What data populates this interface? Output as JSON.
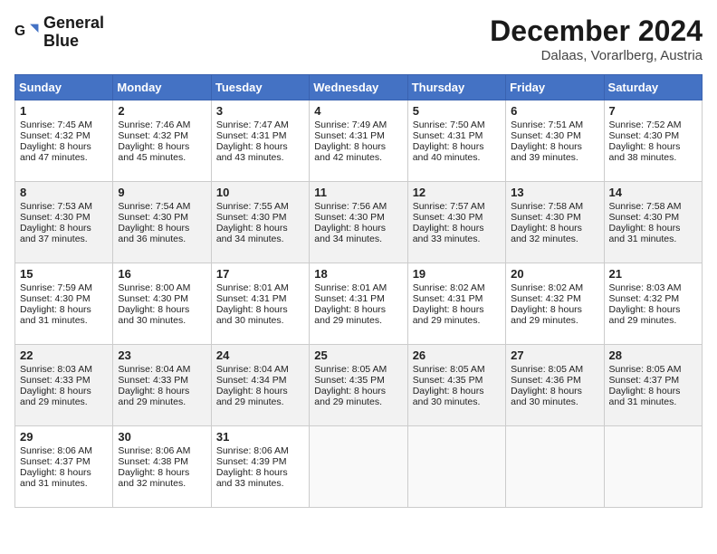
{
  "logo": {
    "line1": "General",
    "line2": "Blue"
  },
  "title": "December 2024",
  "location": "Dalaas, Vorarlberg, Austria",
  "days_of_week": [
    "Sunday",
    "Monday",
    "Tuesday",
    "Wednesday",
    "Thursday",
    "Friday",
    "Saturday"
  ],
  "weeks": [
    [
      {
        "day": 1,
        "sunrise": "7:45 AM",
        "sunset": "4:32 PM",
        "daylight": "8 hours and 47 minutes."
      },
      {
        "day": 2,
        "sunrise": "7:46 AM",
        "sunset": "4:32 PM",
        "daylight": "8 hours and 45 minutes."
      },
      {
        "day": 3,
        "sunrise": "7:47 AM",
        "sunset": "4:31 PM",
        "daylight": "8 hours and 43 minutes."
      },
      {
        "day": 4,
        "sunrise": "7:49 AM",
        "sunset": "4:31 PM",
        "daylight": "8 hours and 42 minutes."
      },
      {
        "day": 5,
        "sunrise": "7:50 AM",
        "sunset": "4:31 PM",
        "daylight": "8 hours and 40 minutes."
      },
      {
        "day": 6,
        "sunrise": "7:51 AM",
        "sunset": "4:30 PM",
        "daylight": "8 hours and 39 minutes."
      },
      {
        "day": 7,
        "sunrise": "7:52 AM",
        "sunset": "4:30 PM",
        "daylight": "8 hours and 38 minutes."
      }
    ],
    [
      {
        "day": 8,
        "sunrise": "7:53 AM",
        "sunset": "4:30 PM",
        "daylight": "8 hours and 37 minutes."
      },
      {
        "day": 9,
        "sunrise": "7:54 AM",
        "sunset": "4:30 PM",
        "daylight": "8 hours and 36 minutes."
      },
      {
        "day": 10,
        "sunrise": "7:55 AM",
        "sunset": "4:30 PM",
        "daylight": "8 hours and 34 minutes."
      },
      {
        "day": 11,
        "sunrise": "7:56 AM",
        "sunset": "4:30 PM",
        "daylight": "8 hours and 34 minutes."
      },
      {
        "day": 12,
        "sunrise": "7:57 AM",
        "sunset": "4:30 PM",
        "daylight": "8 hours and 33 minutes."
      },
      {
        "day": 13,
        "sunrise": "7:58 AM",
        "sunset": "4:30 PM",
        "daylight": "8 hours and 32 minutes."
      },
      {
        "day": 14,
        "sunrise": "7:58 AM",
        "sunset": "4:30 PM",
        "daylight": "8 hours and 31 minutes."
      }
    ],
    [
      {
        "day": 15,
        "sunrise": "7:59 AM",
        "sunset": "4:30 PM",
        "daylight": "8 hours and 31 minutes."
      },
      {
        "day": 16,
        "sunrise": "8:00 AM",
        "sunset": "4:30 PM",
        "daylight": "8 hours and 30 minutes."
      },
      {
        "day": 17,
        "sunrise": "8:01 AM",
        "sunset": "4:31 PM",
        "daylight": "8 hours and 30 minutes."
      },
      {
        "day": 18,
        "sunrise": "8:01 AM",
        "sunset": "4:31 PM",
        "daylight": "8 hours and 29 minutes."
      },
      {
        "day": 19,
        "sunrise": "8:02 AM",
        "sunset": "4:31 PM",
        "daylight": "8 hours and 29 minutes."
      },
      {
        "day": 20,
        "sunrise": "8:02 AM",
        "sunset": "4:32 PM",
        "daylight": "8 hours and 29 minutes."
      },
      {
        "day": 21,
        "sunrise": "8:03 AM",
        "sunset": "4:32 PM",
        "daylight": "8 hours and 29 minutes."
      }
    ],
    [
      {
        "day": 22,
        "sunrise": "8:03 AM",
        "sunset": "4:33 PM",
        "daylight": "8 hours and 29 minutes."
      },
      {
        "day": 23,
        "sunrise": "8:04 AM",
        "sunset": "4:33 PM",
        "daylight": "8 hours and 29 minutes."
      },
      {
        "day": 24,
        "sunrise": "8:04 AM",
        "sunset": "4:34 PM",
        "daylight": "8 hours and 29 minutes."
      },
      {
        "day": 25,
        "sunrise": "8:05 AM",
        "sunset": "4:35 PM",
        "daylight": "8 hours and 29 minutes."
      },
      {
        "day": 26,
        "sunrise": "8:05 AM",
        "sunset": "4:35 PM",
        "daylight": "8 hours and 30 minutes."
      },
      {
        "day": 27,
        "sunrise": "8:05 AM",
        "sunset": "4:36 PM",
        "daylight": "8 hours and 30 minutes."
      },
      {
        "day": 28,
        "sunrise": "8:05 AM",
        "sunset": "4:37 PM",
        "daylight": "8 hours and 31 minutes."
      }
    ],
    [
      {
        "day": 29,
        "sunrise": "8:06 AM",
        "sunset": "4:37 PM",
        "daylight": "8 hours and 31 minutes."
      },
      {
        "day": 30,
        "sunrise": "8:06 AM",
        "sunset": "4:38 PM",
        "daylight": "8 hours and 32 minutes."
      },
      {
        "day": 31,
        "sunrise": "8:06 AM",
        "sunset": "4:39 PM",
        "daylight": "8 hours and 33 minutes."
      },
      null,
      null,
      null,
      null
    ]
  ],
  "labels": {
    "sunrise": "Sunrise:",
    "sunset": "Sunset:",
    "daylight": "Daylight:"
  }
}
